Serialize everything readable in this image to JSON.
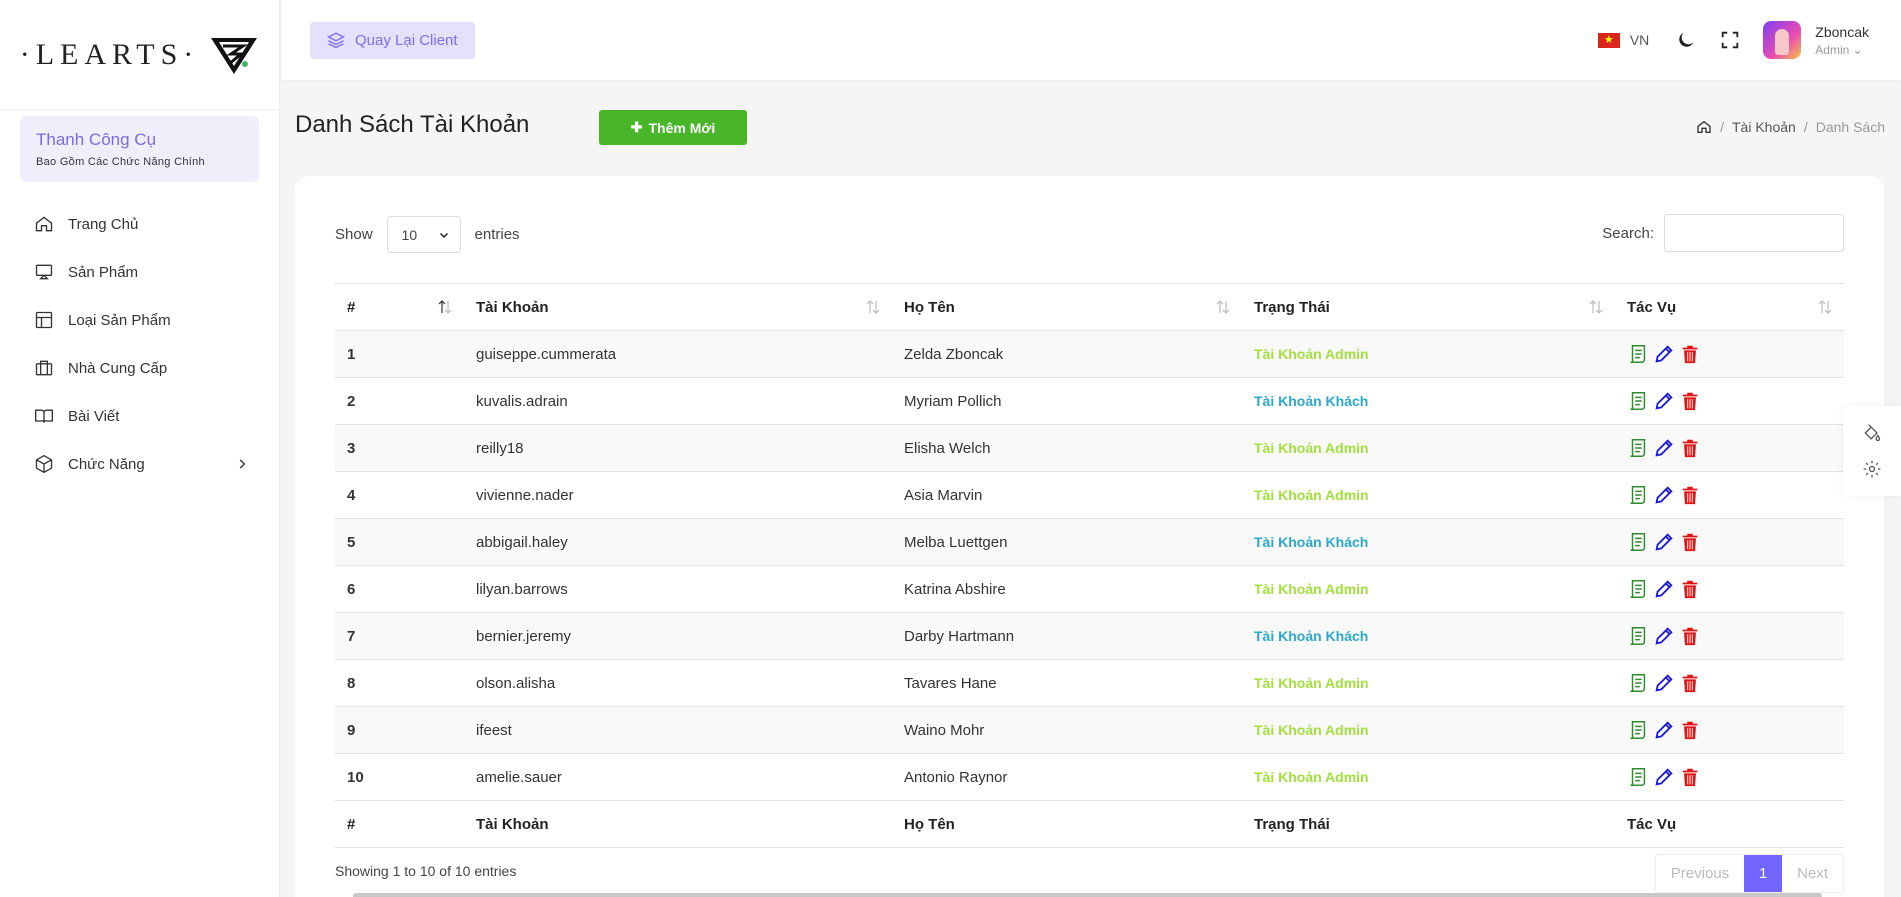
{
  "sidebar": {
    "logo_text": "·LEARTS·",
    "tool_title": "Thanh Công Cụ",
    "tool_subtitle": "Bao Gồm Các Chức Năng Chính",
    "items": [
      {
        "label": "Trang Chủ",
        "icon": "home-icon"
      },
      {
        "label": "Sản Phẩm",
        "icon": "monitor-icon"
      },
      {
        "label": "Loại Sản Phẩm",
        "icon": "layout-icon"
      },
      {
        "label": "Nhà Cung Cấp",
        "icon": "briefcase-icon"
      },
      {
        "label": "Bài Viết",
        "icon": "book-icon"
      },
      {
        "label": "Chức Năng",
        "icon": "box-icon"
      }
    ]
  },
  "topbar": {
    "back_label": "Quay Lại Client",
    "lang": "VN",
    "user_name": "Zboncak",
    "user_role": "Admin"
  },
  "page": {
    "title": "Danh Sách Tài Khoản",
    "add_label": "Thêm Mới",
    "breadcrumb": [
      "Tài Khoản",
      "Danh Sách"
    ]
  },
  "table": {
    "show_label": "Show",
    "length_value": "10",
    "entries_label": "entries",
    "search_label": "Search:",
    "columns": [
      "#",
      "Tài Khoản",
      "Họ Tên",
      "Trạng Thái",
      "Tác Vụ"
    ],
    "rows": [
      {
        "id": "1",
        "username": "guiseppe.cummerata",
        "name": "Zelda Zboncak",
        "status": "Tài Khoản Admin",
        "type": "admin"
      },
      {
        "id": "2",
        "username": "kuvalis.adrain",
        "name": "Myriam Pollich",
        "status": "Tài Khoản Khách",
        "type": "khach"
      },
      {
        "id": "3",
        "username": "reilly18",
        "name": "Elisha Welch",
        "status": "Tài Khoản Admin",
        "type": "admin"
      },
      {
        "id": "4",
        "username": "vivienne.nader",
        "name": "Asia Marvin",
        "status": "Tài Khoản Admin",
        "type": "admin"
      },
      {
        "id": "5",
        "username": "abbigail.haley",
        "name": "Melba Luettgen",
        "status": "Tài Khoản Khách",
        "type": "khach"
      },
      {
        "id": "6",
        "username": "lilyan.barrows",
        "name": "Katrina Abshire",
        "status": "Tài Khoản Admin",
        "type": "admin"
      },
      {
        "id": "7",
        "username": "bernier.jeremy",
        "name": "Darby Hartmann",
        "status": "Tài Khoản Khách",
        "type": "khach"
      },
      {
        "id": "8",
        "username": "olson.alisha",
        "name": "Tavares Hane",
        "status": "Tài Khoản Admin",
        "type": "admin"
      },
      {
        "id": "9",
        "username": "ifeest",
        "name": "Waino Mohr",
        "status": "Tài Khoản Admin",
        "type": "admin"
      },
      {
        "id": "10",
        "username": "amelie.sauer",
        "name": "Antonio Raynor",
        "status": "Tài Khoản Admin",
        "type": "admin"
      }
    ],
    "info": "Showing 1 to 10 of 10 entries",
    "pager": {
      "previous": "Previous",
      "current": "1",
      "next": "Next"
    }
  },
  "colors": {
    "accent": "#7366ff",
    "add_button": "#49b629",
    "status_admin": "#a2e03d",
    "status_khach": "#2ba8cc",
    "view_icon": "#2e8b2e",
    "edit_icon": "#1d1ad6",
    "delete_icon": "#e01414"
  }
}
